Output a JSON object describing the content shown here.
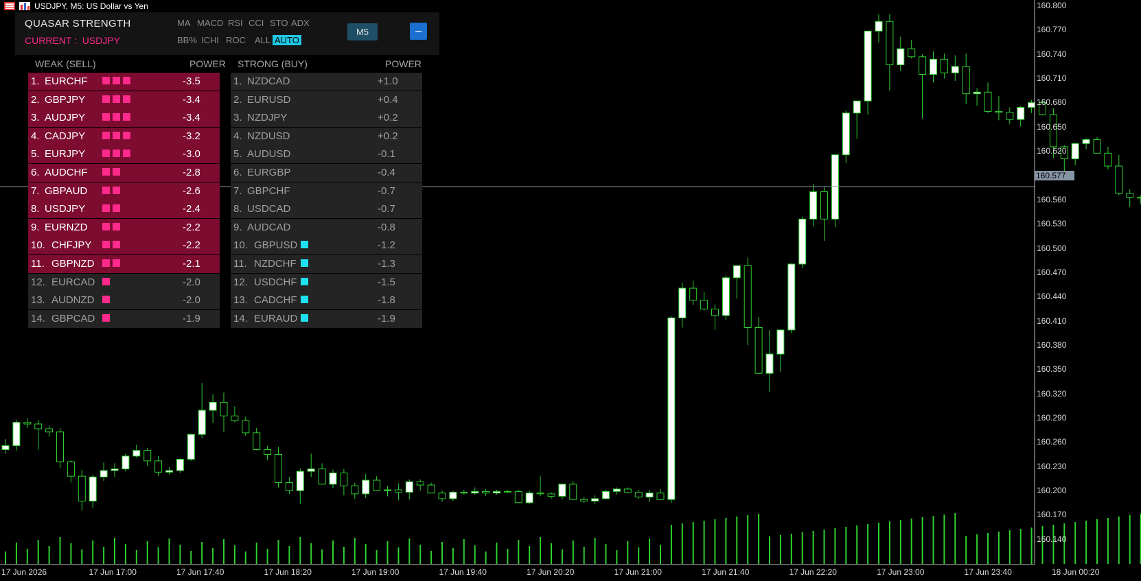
{
  "window_title": "USDJPY, M5:  US Dollar vs Yen",
  "panel": {
    "title": "QUASAR STRENGTH",
    "current_label": "CURRENT :",
    "current_symbol": "USDJPY",
    "tabs_row1": [
      "MA",
      "MACD",
      "RSI",
      "CCI",
      "STO",
      "ADX"
    ],
    "tabs_row2": [
      "BB%",
      "ICHI",
      "ROC",
      "ALL",
      "AUTO"
    ],
    "active_tab": "AUTO",
    "timeframe_button": "M5",
    "minimize_label": "−",
    "weak_header": "WEAK (SELL)",
    "strong_header": "STRONG (BUY)",
    "power_header": "POWER",
    "weak": [
      {
        "rank": "1.",
        "pair": "EURCHF",
        "bars": 3,
        "power": "-3.5",
        "hot": true
      },
      {
        "rank": "2.",
        "pair": "GBPJPY",
        "bars": 3,
        "power": "-3.4",
        "hot": true
      },
      {
        "rank": "3.",
        "pair": "AUDJPY",
        "bars": 3,
        "power": "-3.4",
        "hot": true
      },
      {
        "rank": "4.",
        "pair": "CADJPY",
        "bars": 3,
        "power": "-3.2",
        "hot": true
      },
      {
        "rank": "5.",
        "pair": "EURJPY",
        "bars": 3,
        "power": "-3.0",
        "hot": true
      },
      {
        "rank": "6.",
        "pair": "AUDCHF",
        "bars": 2,
        "power": "-2.8",
        "hot": true
      },
      {
        "rank": "7.",
        "pair": "GBPAUD",
        "bars": 2,
        "power": "-2.6",
        "hot": true
      },
      {
        "rank": "8.",
        "pair": "USDJPY",
        "bars": 2,
        "power": "-2.4",
        "hot": true
      },
      {
        "rank": "9.",
        "pair": "EURNZD",
        "bars": 2,
        "power": "-2.2",
        "hot": true
      },
      {
        "rank": "10.",
        "pair": "CHFJPY",
        "bars": 2,
        "power": "-2.2",
        "hot": true
      },
      {
        "rank": "11.",
        "pair": "GBPNZD",
        "bars": 2,
        "power": "-2.1",
        "hot": true
      },
      {
        "rank": "12.",
        "pair": "EURCAD",
        "bars": 1,
        "power": "-2.0",
        "hot": false
      },
      {
        "rank": "13.",
        "pair": "AUDNZD",
        "bars": 1,
        "power": "-2.0",
        "hot": false
      },
      {
        "rank": "14.",
        "pair": "GBPCAD",
        "bars": 1,
        "power": "-1.9",
        "hot": false
      }
    ],
    "strong": [
      {
        "rank": "1.",
        "pair": "NZDCAD",
        "bars": 0,
        "power": "+1.0"
      },
      {
        "rank": "2.",
        "pair": "EURUSD",
        "bars": 0,
        "power": "+0.4"
      },
      {
        "rank": "3.",
        "pair": "NZDJPY",
        "bars": 0,
        "power": "+0.2"
      },
      {
        "rank": "4.",
        "pair": "NZDUSD",
        "bars": 0,
        "power": "+0.2"
      },
      {
        "rank": "5.",
        "pair": "AUDUSD",
        "bars": 0,
        "power": "-0.1"
      },
      {
        "rank": "6.",
        "pair": "EURGBP",
        "bars": 0,
        "power": "-0.4"
      },
      {
        "rank": "7.",
        "pair": "GBPCHF",
        "bars": 0,
        "power": "-0.7"
      },
      {
        "rank": "8.",
        "pair": "USDCAD",
        "bars": 0,
        "power": "-0.7"
      },
      {
        "rank": "9.",
        "pair": "AUDCAD",
        "bars": 0,
        "power": "-0.8"
      },
      {
        "rank": "10.",
        "pair": "GBPUSD",
        "bars": 1,
        "power": "-1.2"
      },
      {
        "rank": "11.",
        "pair": "NZDCHF",
        "bars": 1,
        "power": "-1.3"
      },
      {
        "rank": "12.",
        "pair": "USDCHF",
        "bars": 1,
        "power": "-1.5"
      },
      {
        "rank": "13.",
        "pair": "CADCHF",
        "bars": 1,
        "power": "-1.8"
      },
      {
        "rank": "14.",
        "pair": "EURAUD",
        "bars": 1,
        "power": "-1.9"
      }
    ]
  },
  "colors": {
    "weak_bar": "#ff2a8c",
    "strong_bar": "#1ee0f0",
    "bull": "#ffffff",
    "bear": "#000000",
    "wick": "#2ed12e",
    "volume": "#2ed12e"
  },
  "price_axis": [
    "160.800",
    "160.770",
    "160.740",
    "160.710",
    "160.680",
    "160.650",
    "160.620",
    "160.590",
    "160.560",
    "160.530",
    "160.500",
    "160.470",
    "160.440",
    "160.410",
    "160.380",
    "160.350",
    "160.320",
    "160.290",
    "160.260",
    "160.230",
    "160.200",
    "160.170",
    "160.140"
  ],
  "current_price": "160.577",
  "time_axis": [
    "17 Jun 2026",
    "17 Jun 17:00",
    "17 Jun 17:40",
    "17 Jun 18:20",
    "17 Jun 19:00",
    "17 Jun 19:40",
    "17 Jun 20:20",
    "17 Jun 21:00",
    "17 Jun 21:40",
    "17 Jun 22:20",
    "17 Jun 23:00",
    "17 Jun 23:40",
    "18 Jun 00:20"
  ],
  "chart_data": {
    "type": "candlestick",
    "symbol": "USDJPY",
    "timeframe": "M5",
    "ylim": [
      160.12,
      160.815
    ],
    "candles": [
      [
        160.263,
        160.276,
        160.258,
        160.268
      ],
      [
        160.268,
        160.3,
        160.262,
        160.297
      ],
      [
        160.297,
        160.302,
        160.29,
        160.295
      ],
      [
        160.295,
        160.3,
        160.263,
        160.289
      ],
      [
        160.289,
        160.293,
        160.279,
        160.285
      ],
      [
        160.285,
        160.29,
        160.24,
        160.248
      ],
      [
        160.248,
        160.25,
        160.222,
        160.23
      ],
      [
        160.23,
        160.238,
        160.187,
        160.199
      ],
      [
        160.199,
        160.232,
        160.19,
        160.229
      ],
      [
        160.229,
        160.247,
        160.224,
        160.237
      ],
      [
        160.237,
        160.246,
        160.229,
        160.239
      ],
      [
        160.239,
        160.258,
        160.236,
        160.255
      ],
      [
        160.255,
        160.269,
        160.253,
        160.262
      ],
      [
        160.262,
        160.265,
        160.243,
        160.249
      ],
      [
        160.249,
        160.255,
        160.23,
        160.235
      ],
      [
        160.235,
        160.241,
        160.232,
        160.237
      ],
      [
        160.237,
        160.252,
        160.234,
        160.251
      ],
      [
        160.251,
        160.283,
        160.249,
        160.282
      ],
      [
        160.282,
        160.346,
        160.277,
        160.312
      ],
      [
        160.312,
        160.332,
        160.296,
        160.322
      ],
      [
        160.322,
        160.334,
        160.285,
        160.305
      ],
      [
        160.305,
        160.317,
        160.297,
        160.299
      ],
      [
        160.299,
        160.304,
        160.28,
        160.284
      ],
      [
        160.284,
        160.29,
        160.262,
        160.263
      ],
      [
        160.263,
        160.268,
        160.25,
        160.257
      ],
      [
        160.257,
        160.266,
        160.216,
        160.222
      ],
      [
        160.222,
        160.229,
        160.208,
        160.212
      ],
      [
        160.212,
        160.24,
        160.195,
        160.236
      ],
      [
        160.236,
        160.258,
        160.229,
        160.239
      ],
      [
        160.239,
        160.246,
        160.221,
        160.22
      ],
      [
        160.22,
        160.238,
        160.215,
        160.234
      ],
      [
        160.234,
        160.239,
        160.206,
        160.218
      ],
      [
        160.218,
        160.222,
        160.202,
        160.208
      ],
      [
        160.208,
        160.233,
        160.203,
        160.225
      ],
      [
        160.225,
        160.23,
        160.214,
        160.212
      ],
      [
        160.212,
        160.218,
        160.205,
        160.213
      ],
      [
        160.213,
        160.221,
        160.2,
        160.21
      ],
      [
        160.21,
        160.226,
        160.201,
        160.223
      ],
      [
        160.223,
        160.226,
        160.212,
        160.219
      ],
      [
        160.219,
        160.222,
        160.209,
        160.209
      ],
      [
        160.209,
        160.212,
        160.198,
        160.202
      ],
      [
        160.202,
        160.212,
        160.199,
        160.21
      ],
      [
        160.21,
        160.213,
        160.207,
        160.209
      ],
      [
        160.209,
        160.216,
        160.207,
        160.211
      ],
      [
        160.211,
        160.214,
        160.205,
        160.209
      ],
      [
        160.209,
        160.213,
        160.207,
        160.211
      ],
      [
        160.211,
        160.213,
        160.209,
        160.211
      ],
      [
        160.211,
        160.213,
        160.198,
        160.197
      ],
      [
        160.197,
        160.212,
        160.195,
        160.209
      ],
      [
        160.209,
        160.23,
        160.205,
        160.208
      ],
      [
        160.208,
        160.21,
        160.202,
        160.205
      ],
      [
        160.205,
        160.221,
        160.201,
        160.22
      ],
      [
        160.22,
        160.224,
        160.201,
        160.201
      ],
      [
        160.201,
        160.204,
        160.197,
        160.199
      ],
      [
        160.199,
        160.206,
        160.195,
        160.202
      ],
      [
        160.202,
        160.213,
        160.201,
        160.211
      ],
      [
        160.211,
        160.216,
        160.207,
        160.214
      ],
      [
        160.214,
        160.216,
        160.209,
        160.21
      ],
      [
        160.21,
        160.213,
        160.202,
        160.204
      ],
      [
        160.204,
        160.213,
        160.198,
        160.209
      ],
      [
        160.209,
        160.214,
        160.2,
        160.201
      ],
      [
        160.201,
        160.429,
        160.197,
        160.427
      ],
      [
        160.427,
        160.471,
        160.415,
        160.464
      ],
      [
        160.464,
        160.473,
        160.443,
        160.449
      ],
      [
        160.449,
        160.459,
        160.436,
        160.438
      ],
      [
        160.438,
        160.444,
        160.412,
        160.43
      ],
      [
        160.43,
        160.48,
        160.424,
        160.477
      ],
      [
        160.477,
        160.491,
        160.451,
        160.492
      ],
      [
        160.492,
        160.502,
        160.393,
        160.415
      ],
      [
        160.415,
        160.428,
        160.368,
        160.358
      ],
      [
        160.358,
        160.412,
        160.335,
        160.382
      ],
      [
        160.382,
        160.412,
        160.36,
        160.412
      ],
      [
        160.412,
        160.495,
        160.408,
        160.494
      ],
      [
        160.494,
        160.553,
        160.489,
        160.55
      ],
      [
        160.55,
        160.594,
        160.541,
        160.584
      ],
      [
        160.584,
        160.59,
        160.523,
        160.55
      ],
      [
        160.55,
        160.59,
        160.54,
        160.63
      ],
      [
        160.63,
        160.685,
        160.62,
        160.682
      ],
      [
        160.682,
        160.695,
        160.65,
        160.697
      ],
      [
        160.697,
        160.781,
        160.68,
        160.784
      ],
      [
        160.784,
        160.805,
        160.77,
        160.796
      ],
      [
        160.796,
        160.805,
        160.71,
        160.742
      ],
      [
        160.742,
        160.777,
        160.734,
        160.762
      ],
      [
        160.762,
        160.773,
        160.75,
        160.752
      ],
      [
        160.752,
        160.755,
        160.675,
        160.73
      ],
      [
        160.73,
        160.759,
        160.72,
        160.749
      ],
      [
        160.749,
        160.756,
        160.725,
        160.732
      ],
      [
        160.732,
        160.754,
        160.722,
        160.74
      ],
      [
        160.74,
        160.756,
        160.693,
        160.706
      ],
      [
        160.706,
        160.713,
        160.691,
        160.708
      ],
      [
        160.708,
        160.72,
        160.682,
        160.684
      ],
      [
        160.684,
        160.703,
        160.673,
        160.683
      ],
      [
        160.683,
        160.689,
        160.668,
        160.674
      ],
      [
        160.674,
        160.691,
        160.665,
        160.689
      ],
      [
        160.689,
        160.698,
        160.682,
        160.695
      ],
      [
        160.695,
        160.699,
        160.679,
        160.68
      ],
      [
        160.68,
        160.688,
        160.626,
        160.64
      ],
      [
        160.64,
        160.642,
        160.608,
        160.625
      ],
      [
        160.625,
        160.645,
        160.617,
        160.644
      ],
      [
        160.644,
        160.651,
        160.637,
        160.649
      ],
      [
        160.649,
        160.652,
        160.637,
        160.632
      ],
      [
        160.632,
        160.64,
        160.612,
        160.616
      ],
      [
        160.616,
        160.63,
        160.58,
        160.582
      ],
      [
        160.582,
        160.587,
        160.565,
        160.577
      ],
      [
        160.577,
        160.58,
        160.569,
        160.577
      ]
    ]
  }
}
